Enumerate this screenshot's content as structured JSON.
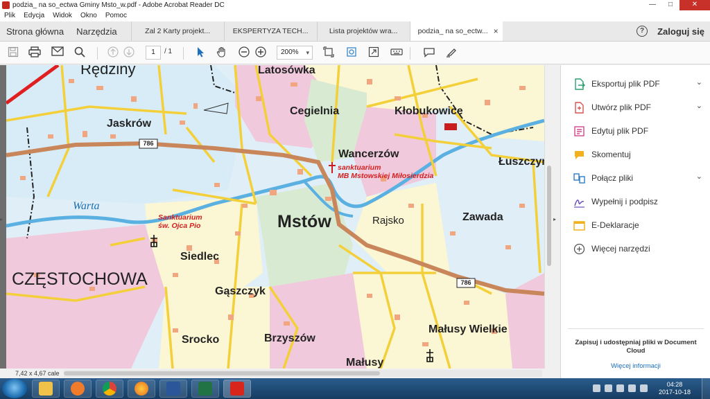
{
  "window": {
    "title": "podzia_ na so_ectwa Gminy Msto_w.pdf - Adobe Acrobat Reader DC"
  },
  "menu": [
    "Plik",
    "Edycja",
    "Widok",
    "Okno",
    "Pomoc"
  ],
  "tabs": {
    "home": "Strona główna",
    "tools": "Narzędzia",
    "documents": [
      {
        "label": "Zal 2 Karty projekt..."
      },
      {
        "label": "EKSPERTYZA TECH..."
      },
      {
        "label": "Lista projektów wra..."
      },
      {
        "label": "podzia_ na so_ectw..."
      }
    ],
    "close_glyph": "×",
    "help_glyph": "?",
    "login": "Zaloguj się"
  },
  "toolbar": {
    "page_current": "1",
    "page_total": "/ 1",
    "zoom": "200%"
  },
  "map": {
    "places": [
      {
        "label": "Rędziny"
      },
      {
        "label": "Latosówka"
      },
      {
        "label": "Cegielnia"
      },
      {
        "label": "Kłobukowice"
      },
      {
        "label": "Jaskrów"
      },
      {
        "label": "Wancerzów"
      },
      {
        "label": "Łuszczyn"
      },
      {
        "label": "Warta"
      },
      {
        "label": "Mstów"
      },
      {
        "label": "Rajsko"
      },
      {
        "label": "Zawada"
      },
      {
        "label": "Siedlec"
      },
      {
        "label": "CZĘSTOCHOWA"
      },
      {
        "label": "Gąszczyk"
      },
      {
        "label": "Małusy Wielkie"
      },
      {
        "label": "Srocko"
      },
      {
        "label": "Brzyszów"
      },
      {
        "label": "Małusy"
      }
    ],
    "sanctuary1_line1": "sanktuarium",
    "sanctuary1_line2": "MB Mstowskiej Miłosierdzia",
    "sanctuary2_line1": "Sanktuarium",
    "sanctuary2_line2": "św. Ojca Pio",
    "road_number": "786",
    "colors": {
      "water": "#5ab0e0",
      "road_major": "#c8865a",
      "road_minor": "#f3cf3a",
      "pink": "#f1c9dc",
      "light_blue": "#d8ecf7",
      "yellow": "#fbf6d3",
      "green": "#d9ead3"
    }
  },
  "status": {
    "dimensions": "7,42 x 4,67 cale"
  },
  "right_panel": {
    "tools": [
      {
        "label": "Eksportuj plik PDF",
        "icon": "export-pdf-icon",
        "color": "#2d9e6f",
        "has_chevron": true
      },
      {
        "label": "Utwórz plik PDF",
        "icon": "create-pdf-icon",
        "color": "#d9534f",
        "has_chevron": true
      },
      {
        "label": "Edytuj plik PDF",
        "icon": "edit-pdf-icon",
        "color": "#d6458c",
        "has_chevron": false
      },
      {
        "label": "Skomentuj",
        "icon": "comment-icon",
        "color": "#f2b01e",
        "has_chevron": false
      },
      {
        "label": "Połącz pliki",
        "icon": "combine-files-icon",
        "color": "#2a7dc9",
        "has_chevron": true
      },
      {
        "label": "Wypełnij i podpisz",
        "icon": "fill-sign-icon",
        "color": "#6b4fb8",
        "has_chevron": false
      },
      {
        "label": "E-Deklaracje",
        "icon": "e-declaration-icon",
        "color": "#f2b01e",
        "has_chevron": false
      },
      {
        "label": "Więcej narzędzi",
        "icon": "more-tools-icon",
        "color": "#555555",
        "has_chevron": false
      }
    ],
    "chevron": "⌄",
    "promo_text": "Zapisuj i udostępniaj pliki w Document Cloud",
    "promo_link": "Więcej informacji"
  },
  "taskbar": {
    "time": "04:28",
    "date": "2017-10-18",
    "apps": [
      {
        "icon": "explorer-icon",
        "color": "#f1c24a"
      },
      {
        "icon": "media-player-icon",
        "color": "#f07b2a"
      },
      {
        "icon": "chrome-icon",
        "color": "#4caf50"
      },
      {
        "icon": "firefox-icon",
        "color": "#e66a1f"
      },
      {
        "icon": "word-icon",
        "color": "#2b579a"
      },
      {
        "icon": "excel-icon",
        "color": "#217346"
      },
      {
        "icon": "acrobat-icon",
        "color": "#d9261c"
      }
    ]
  }
}
